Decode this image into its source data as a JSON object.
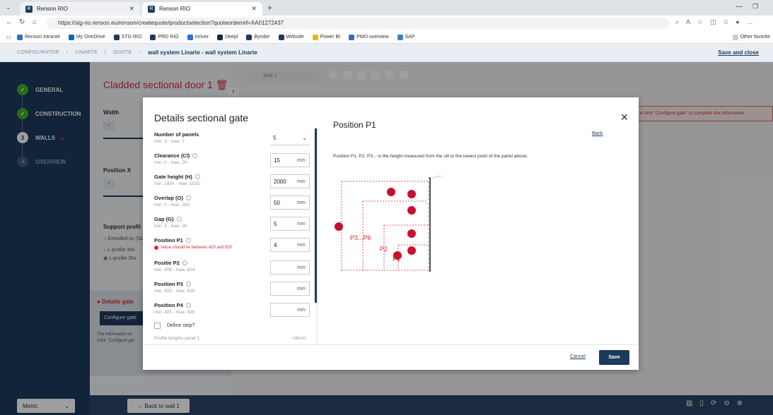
{
  "browser": {
    "tabs": [
      {
        "label": "Renson RIO"
      },
      {
        "label": "Renson RIO"
      }
    ],
    "url": "https://stg-rio.renson.eu/renson/createquote/productselection?quoteorderref=AA01272437",
    "favorites": [
      "Renson Intranet",
      "My OneDrive",
      "STG RIO",
      "PRD RIO",
      "Inriver",
      "Deepl",
      "Bynder",
      "Website",
      "Power BI",
      "PMO overview",
      "SAP"
    ],
    "other_favorites": "Other favorite"
  },
  "header": {
    "breadcrumb": [
      "CONFIGURATOR",
      "LINARTE",
      "QUOTE"
    ],
    "title": "wall system Linarte - wall system Linarte",
    "save_close": "Save and close"
  },
  "steps": [
    {
      "label": "GENERAL",
      "state": "done"
    },
    {
      "label": "CONSTRUCTION",
      "state": "done"
    },
    {
      "label": "WALLS",
      "num": "3",
      "state": "current"
    },
    {
      "label": "OVERVIEW",
      "num": "4",
      "state": "disabled"
    }
  ],
  "main": {
    "door_title": "Cladded sectional door 1",
    "width_label": "Width",
    "position_x_label": "Position X",
    "support_label": "Support profil",
    "support_options": [
      "Extruded su (Standard)",
      "L-profile 30x",
      "L-profile 35x"
    ],
    "details_gate": "Details gate",
    "configure_gate_btn": "Configure gate",
    "info_text": "The information on Click \"Configure gat",
    "wall_tab": "Wall 1",
    "red_message": "e click \"Configure gate\" to complete the information.",
    "back_to_wall": "← Back to wall 1",
    "metric": "Metric"
  },
  "modal": {
    "title": "Details sectional gate",
    "fields": [
      {
        "name": "Number of panels",
        "hint": "min. 3 - max. 7",
        "value": "5",
        "type": "select"
      },
      {
        "name": "Clearance (Cl)",
        "hint": "min. 0 - max. 30",
        "value": "15",
        "unit": "mm"
      },
      {
        "name": "Gate height (H)",
        "hint": "min. 1800 - max. 2515",
        "value": "2000",
        "unit": "mm"
      },
      {
        "name": "Overlap (O)",
        "hint": "min. 0 - max. 300",
        "value": "50",
        "unit": "mm"
      },
      {
        "name": "Gap (G)",
        "hint": "min. 3 - max. 30",
        "value": "5",
        "unit": "mm"
      },
      {
        "name": "Position P1",
        "error": "Value should lie between 420 and 820",
        "value": "4",
        "unit": "mm"
      },
      {
        "name": "Positie P2",
        "hint": "min. 409 - max. 824",
        "value": "",
        "unit": "mm"
      },
      {
        "name": "Position P3",
        "hint": "min. 405 - max. 820",
        "value": "",
        "unit": "mm"
      },
      {
        "name": "Position P4",
        "hint": "min. 405 - max. 820",
        "value": "",
        "unit": "mm"
      }
    ],
    "define_step": "Define step?",
    "profile_lengths": "Profile lengths panel 1",
    "profile_value": "-18mm",
    "right_title": "Position P1",
    "back": "Back",
    "description": "Position P1, P2, P3... is the height measured from the sill to the lowest point of the panel above:",
    "diagram_labels": {
      "p3p6": "P3...P6",
      "p2": "P2",
      "p1": "P1"
    },
    "cancel": "Cancel",
    "save": "Save"
  },
  "colors": {
    "navy": "#1c3a5e",
    "red": "#d12f3a",
    "green": "#43b02a"
  }
}
